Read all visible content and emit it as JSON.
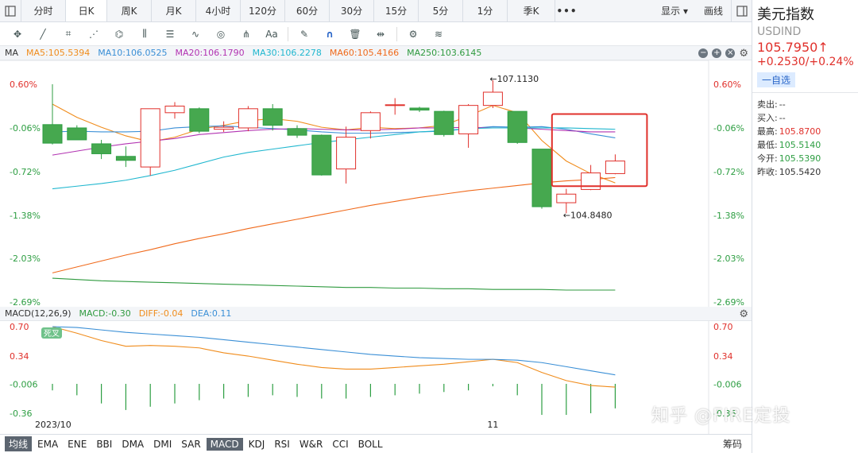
{
  "tabs": [
    "分时",
    "日K",
    "周K",
    "月K",
    "4小时",
    "120分",
    "60分",
    "30分",
    "15分",
    "5分",
    "1分",
    "季K",
    "•••"
  ],
  "active_tab": 1,
  "topbar_right": {
    "display": "显示",
    "draw": "画线"
  },
  "tools": [
    "move-cross-icon",
    "line-icon",
    "crop-icon",
    "fan-icon",
    "pattern-icon",
    "channel-icon",
    "levels-icon",
    "wave-icon",
    "cycle-icon",
    "pitchfork-icon",
    "text-icon",
    "pen-icon",
    "magnet-icon",
    "trash-icon",
    "resize-icon",
    "settings-icon",
    "layers-icon"
  ],
  "ma_legend": {
    "name": "MA",
    "items": [
      {
        "label": "MA5:105.5394",
        "color": "#f08c1c"
      },
      {
        "label": "MA10:106.0525",
        "color": "#3a8fd6"
      },
      {
        "label": "MA20:106.1790",
        "color": "#b233b2"
      },
      {
        "label": "MA30:106.2278",
        "color": "#20b7cf"
      },
      {
        "label": "MA60:105.4166",
        "color": "#f06a1c"
      },
      {
        "label": "MA250:103.6145",
        "color": "#2f9a3f"
      }
    ]
  },
  "macd_legend": {
    "name": "MACD(12,26,9)",
    "items": [
      {
        "label": "MACD:-0.30",
        "color": "#2f9a3f"
      },
      {
        "label": "DIFF:-0.04",
        "color": "#f08c1c"
      },
      {
        "label": "DEA:0.11",
        "color": "#3a8fd6"
      }
    ]
  },
  "macd_badge": "死叉",
  "chart_data": [
    {
      "type": "candlestick",
      "ylabels": [
        "0.60%",
        "-0.06%",
        "-0.72%",
        "-1.38%",
        "-2.03%",
        "-2.69%"
      ],
      "ylim": [
        -2.69,
        0.66
      ],
      "xticks": [
        "2023/10",
        "11"
      ],
      "annotations": [
        {
          "text": "←107.1130",
          "bar": 18,
          "value": 0.66,
          "pos": "top"
        },
        {
          "text": "←104.8480",
          "bar": 21,
          "value": -1.35,
          "pos": "bottom"
        }
      ],
      "candles": [
        {
          "open": -0.01,
          "high": 0.6,
          "low": -0.31,
          "close": -0.29
        },
        {
          "open": -0.06,
          "high": -0.02,
          "low": -0.22,
          "close": -0.24
        },
        {
          "open": -0.3,
          "high": -0.24,
          "low": -0.53,
          "close": -0.45
        },
        {
          "open": -0.49,
          "high": -0.34,
          "low": -0.65,
          "close": -0.55
        },
        {
          "open": -0.65,
          "high": 0.23,
          "low": -0.78,
          "close": 0.23
        },
        {
          "open": 0.17,
          "high": 0.33,
          "low": 0.08,
          "close": 0.27
        },
        {
          "open": 0.23,
          "high": 0.25,
          "low": -0.14,
          "close": -0.11
        },
        {
          "open": -0.08,
          "high": 0.04,
          "low": -0.12,
          "close": -0.05
        },
        {
          "open": -0.06,
          "high": 0.27,
          "low": -0.11,
          "close": 0.23
        },
        {
          "open": 0.23,
          "high": 0.3,
          "low": -0.1,
          "close": -0.02
        },
        {
          "open": -0.07,
          "high": -0.02,
          "low": -0.21,
          "close": -0.17
        },
        {
          "open": -0.17,
          "high": -0.16,
          "low": -0.78,
          "close": -0.77
        },
        {
          "open": -0.68,
          "high": -0.04,
          "low": -0.9,
          "close": -0.2
        },
        {
          "open": -0.1,
          "high": 0.19,
          "low": -0.22,
          "close": 0.17
        },
        {
          "open": 0.28,
          "high": 0.39,
          "low": 0.14,
          "close": 0.29
        },
        {
          "open": 0.24,
          "high": 0.26,
          "low": 0.18,
          "close": 0.21
        },
        {
          "open": 0.19,
          "high": 0.2,
          "low": -0.19,
          "close": -0.16
        },
        {
          "open": -0.15,
          "high": 0.3,
          "low": -0.36,
          "close": 0.28
        },
        {
          "open": 0.28,
          "high": 0.66,
          "low": 0.24,
          "close": 0.48
        },
        {
          "open": 0.19,
          "high": 0.16,
          "low": -0.3,
          "close": -0.28
        },
        {
          "open": -0.38,
          "high": -0.38,
          "low": -1.28,
          "close": -1.25
        },
        {
          "open": -1.19,
          "high": -0.98,
          "low": -1.35,
          "close": -1.06
        },
        {
          "open": -0.99,
          "high": -0.62,
          "low": -1.0,
          "close": -0.74
        },
        {
          "open": -0.75,
          "high": -0.46,
          "low": -0.76,
          "close": -0.56
        }
      ],
      "series": [
        {
          "name": "MA5",
          "color": "#f08c1c",
          "values": [
            0.3,
            0.1,
            -0.05,
            -0.18,
            -0.27,
            -0.2,
            -0.08,
            -0.02,
            0.05,
            0.08,
            0.04,
            -0.05,
            -0.09,
            -0.05,
            -0.07,
            -0.06,
            -0.02,
            0.12,
            0.28,
            0.17,
            -0.25,
            -0.56,
            -0.75,
            -0.89
          ]
        },
        {
          "name": "MA10",
          "color": "#3a8fd6",
          "values": [
            -0.12,
            -0.11,
            -0.12,
            -0.12,
            -0.11,
            -0.06,
            -0.04,
            -0.03,
            -0.05,
            -0.07,
            -0.09,
            -0.12,
            -0.14,
            -0.14,
            -0.13,
            -0.12,
            -0.11,
            -0.07,
            -0.04,
            -0.05,
            -0.04,
            -0.08,
            -0.15,
            -0.21
          ]
        },
        {
          "name": "MA20",
          "color": "#b233b2",
          "values": [
            -0.47,
            -0.41,
            -0.35,
            -0.3,
            -0.26,
            -0.22,
            -0.16,
            -0.13,
            -0.1,
            -0.08,
            -0.07,
            -0.08,
            -0.09,
            -0.09,
            -0.08,
            -0.06,
            -0.06,
            -0.05,
            -0.06,
            -0.06,
            -0.08,
            -0.1,
            -0.12,
            -0.12
          ]
        },
        {
          "name": "MA30",
          "color": "#20b7cf",
          "values": [
            -0.98,
            -0.94,
            -0.9,
            -0.85,
            -0.78,
            -0.7,
            -0.6,
            -0.5,
            -0.43,
            -0.38,
            -0.33,
            -0.28,
            -0.24,
            -0.2,
            -0.16,
            -0.12,
            -0.1,
            -0.07,
            -0.06,
            -0.06,
            -0.06,
            -0.06,
            -0.07,
            -0.08
          ]
        },
        {
          "name": "MA60",
          "color": "#f06a1c",
          "values": [
            -2.25,
            -2.16,
            -2.07,
            -1.98,
            -1.9,
            -1.81,
            -1.73,
            -1.66,
            -1.58,
            -1.51,
            -1.44,
            -1.37,
            -1.3,
            -1.23,
            -1.17,
            -1.11,
            -1.06,
            -1.01,
            -0.97,
            -0.93,
            -0.89,
            -0.86,
            -0.84,
            -0.81
          ]
        },
        {
          "name": "MA250",
          "color": "#2f9a3f",
          "values": [
            -2.33,
            -2.35,
            -2.37,
            -2.38,
            -2.39,
            -2.4,
            -2.41,
            -2.42,
            -2.43,
            -2.44,
            -2.45,
            -2.46,
            -2.47,
            -2.47,
            -2.48,
            -2.48,
            -2.49,
            -2.49,
            -2.5,
            -2.5,
            -2.5,
            -2.51,
            -2.51,
            -2.51
          ]
        }
      ]
    },
    {
      "type": "macd",
      "ylabels": [
        "0.70",
        "0.34",
        "-0.006",
        "-0.36"
      ],
      "ylim": [
        -0.36,
        0.7
      ],
      "histogram": [
        -0.08,
        -0.14,
        -0.24,
        -0.32,
        -0.28,
        -0.24,
        -0.2,
        -0.18,
        -0.16,
        -0.14,
        -0.16,
        -0.18,
        -0.18,
        -0.16,
        -0.14,
        -0.12,
        -0.1,
        -0.08,
        -0.03,
        -0.14,
        -0.38,
        -0.38,
        -0.36,
        -0.3
      ],
      "series": [
        {
          "name": "DIFF",
          "color": "#f08c1c",
          "values": [
            0.7,
            0.62,
            0.53,
            0.46,
            0.47,
            0.46,
            0.44,
            0.38,
            0.34,
            0.29,
            0.24,
            0.2,
            0.18,
            0.18,
            0.2,
            0.22,
            0.24,
            0.27,
            0.3,
            0.26,
            0.14,
            0.04,
            -0.02,
            -0.04
          ]
        },
        {
          "name": "DEA",
          "color": "#3a8fd6",
          "values": [
            0.7,
            0.69,
            0.66,
            0.63,
            0.61,
            0.59,
            0.57,
            0.54,
            0.51,
            0.48,
            0.45,
            0.42,
            0.39,
            0.36,
            0.34,
            0.32,
            0.31,
            0.3,
            0.3,
            0.29,
            0.26,
            0.21,
            0.16,
            0.11
          ]
        }
      ]
    }
  ],
  "highlight_box_color": "#e0302b",
  "indicator_tabs": [
    "均线",
    "EMA",
    "ENE",
    "BBI",
    "DMA",
    "DMI",
    "SAR",
    "MACD",
    "KDJ",
    "RSI",
    "W&R",
    "CCI",
    "BOLL"
  ],
  "active_indicators": [
    0,
    7
  ],
  "chip_label": "筹码",
  "panel": {
    "name": "美元指数",
    "code": "USDIND",
    "price": "105.7950↑",
    "change": "+0.2530/+0.24%",
    "watch": "一自选",
    "rows": [
      {
        "label": "卖出:",
        "value": "--",
        "tone": ""
      },
      {
        "label": "买入:",
        "value": "--",
        "tone": ""
      },
      {
        "label": "最高:",
        "value": "105.8700",
        "tone": "red"
      },
      {
        "label": "最低:",
        "value": "105.5140",
        "tone": "green"
      },
      {
        "label": "今开:",
        "value": "105.5390",
        "tone": "green"
      },
      {
        "label": "昨收:",
        "value": "105.5420",
        "tone": ""
      }
    ]
  },
  "watermark": "知乎 @FIRE定投"
}
